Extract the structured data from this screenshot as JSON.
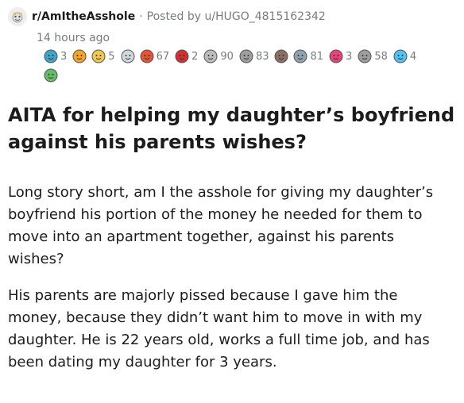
{
  "post": {
    "subreddit": "r/AmItheAsshole",
    "separator": "·",
    "posted_by": "Posted by u/HUGO_4815162342",
    "time": "14 hours ago",
    "title": "AITA for helping my daughter’s boyfriend against his parents wishes?",
    "paragraphs": [
      "Long story short, am I the asshole for giving my daughter’s boyfriend his portion of the money he needed for them to move into an apartment together, against his parents wishes?",
      "His parents are majorly pissed because I gave him the money, because they didn’t want him to move in with my daughter. He is 22 years old, works a full time job, and has been dating my daughter for 3 years."
    ]
  },
  "awards": [
    {
      "icon": "helpful-award-icon",
      "count": "3",
      "color": "#3aa6c9"
    },
    {
      "icon": "heart-eyes-award-icon",
      "count": "",
      "color": "#f5a623"
    },
    {
      "icon": "wholesome-award-icon",
      "count": "5",
      "color": "#f2c94c"
    },
    {
      "icon": "hand-wave-award-icon",
      "count": "",
      "color": "#cfd8dc"
    },
    {
      "icon": "rocket-like-award-icon",
      "count": "67",
      "color": "#e8542f"
    },
    {
      "icon": "heart-award-icon",
      "count": "2",
      "color": "#d32f2f"
    },
    {
      "icon": "facepalm-award-icon",
      "count": "90",
      "color": "#bdbdbd"
    },
    {
      "icon": "confused-award-icon",
      "count": "83",
      "color": "#9e9e9e"
    },
    {
      "icon": "party-award-icon",
      "count": "",
      "color": "#8d6e63"
    },
    {
      "icon": "silver-coin-award-icon",
      "count": "81",
      "color": "#90a4ae"
    },
    {
      "icon": "love-face-award-icon",
      "count": "3",
      "color": "#ec407a"
    },
    {
      "icon": "shocked-award-icon",
      "count": "58",
      "color": "#9e9e9e"
    },
    {
      "icon": "angel-award-icon",
      "count": "4",
      "color": "#4fc3f7"
    },
    {
      "icon": "plant-award-icon",
      "count": "",
      "color": "#66bb6a"
    }
  ]
}
